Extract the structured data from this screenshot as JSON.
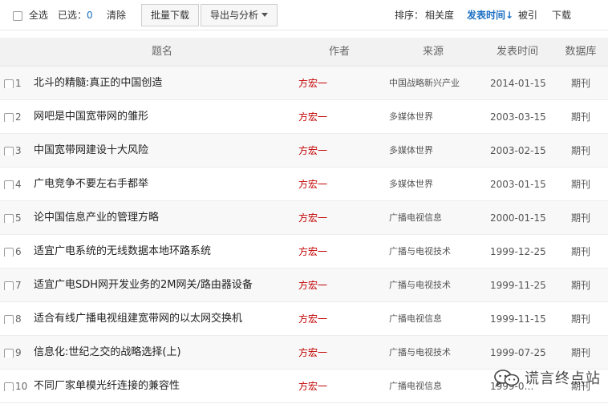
{
  "toolbar": {
    "select_all": "全选",
    "selected_label": "已选：",
    "selected_count": "0",
    "clear": "清除",
    "batch_download": "批量下载",
    "export_analysis": "导出与分析",
    "sort_label": "排序：",
    "sort_options": [
      "相关度",
      "发表时间",
      "被引",
      "下载"
    ],
    "sort_active": "发表时间",
    "sort_direction_glyph": "↓"
  },
  "table": {
    "headers": {
      "title": "题名",
      "author": "作者",
      "source": "来源",
      "date": "发表时间",
      "db": "数据库"
    },
    "rows": [
      {
        "num": "1",
        "title": "北斗的精髓:真正的中国创造",
        "author": "方宏一",
        "source": "中国战略新兴产业",
        "date": "2014-01-15",
        "db": "期刊"
      },
      {
        "num": "2",
        "title": "网吧是中国宽带网的雏形",
        "author": "方宏一",
        "source": "多媒体世界",
        "date": "2003-03-15",
        "db": "期刊"
      },
      {
        "num": "3",
        "title": "中国宽带网建设十大风险",
        "author": "方宏一",
        "source": "多媒体世界",
        "date": "2003-02-15",
        "db": "期刊"
      },
      {
        "num": "4",
        "title": "广电竞争不要左右手都举",
        "author": "方宏一",
        "source": "多媒体世界",
        "date": "2003-01-15",
        "db": "期刊"
      },
      {
        "num": "5",
        "title": "论中国信息产业的管理方略",
        "author": "方宏一",
        "source": "广播电视信息",
        "date": "2000-01-15",
        "db": "期刊"
      },
      {
        "num": "6",
        "title": "适宜广电系统的无线数据本地环路系统",
        "author": "方宏一",
        "source": "广播与电视技术",
        "date": "1999-12-25",
        "db": "期刊"
      },
      {
        "num": "7",
        "title": "适宜广电SDH网开发业务的2M网关/路由器设备",
        "author": "方宏一",
        "source": "广播与电视技术",
        "date": "1999-11-25",
        "db": "期刊"
      },
      {
        "num": "8",
        "title": "适合有线广播电视组建宽带网的以太网交换机",
        "author": "方宏一",
        "source": "广播电视信息",
        "date": "1999-11-15",
        "db": "期刊"
      },
      {
        "num": "9",
        "title": "信息化:世纪之交的战略选择(上)",
        "author": "方宏一",
        "source": "广播与电视技术",
        "date": "1999-07-25",
        "db": "期刊"
      },
      {
        "num": "10",
        "title": "不同厂家单模光纤连接的兼容性",
        "author": "方宏一",
        "source": "广播电视信息",
        "date": "1999-0…",
        "db": "期刊"
      }
    ]
  },
  "watermark": {
    "text": "谎言终点站",
    "icon": "wechat-icon"
  }
}
